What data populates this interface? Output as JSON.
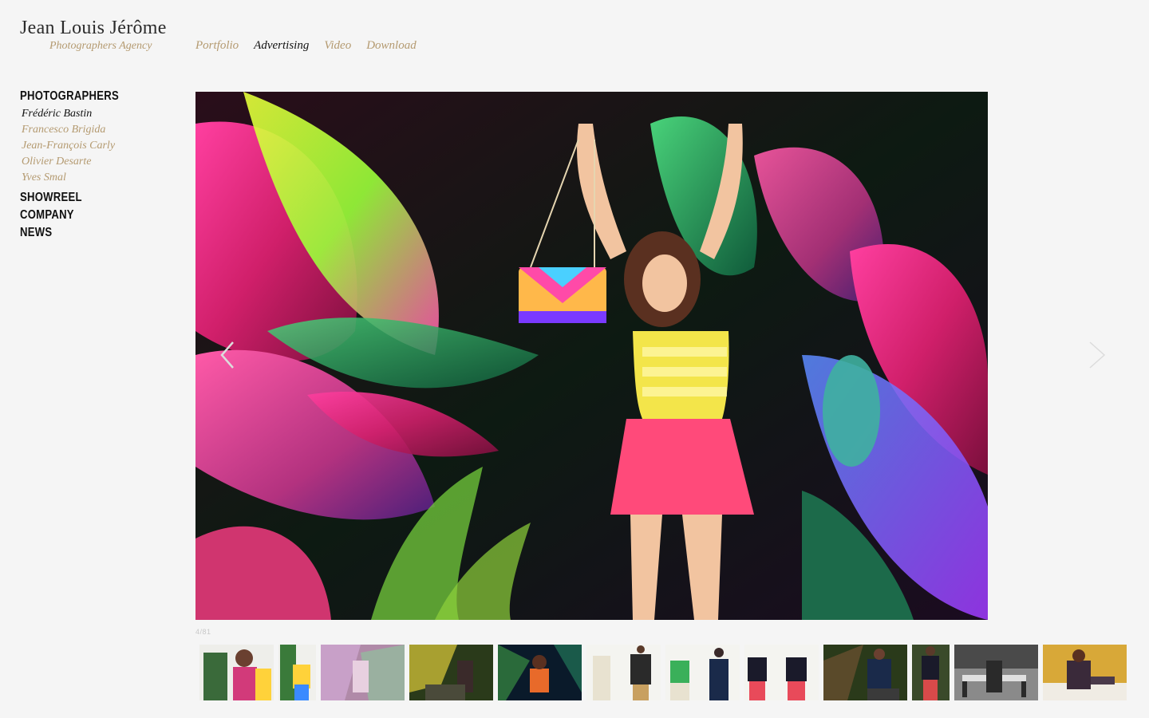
{
  "brand": {
    "title": "Jean Louis Jérôme",
    "subtitle": "Photographers Agency"
  },
  "topnav": {
    "items": [
      "Portfolio",
      "Advertising",
      "Video",
      "Download"
    ],
    "active": "Advertising"
  },
  "sidebar": {
    "photographers_heading": "PHOTOGRAPHERS",
    "photographers": [
      "Frédéric Bastin",
      "Francesco Brigida",
      "Jean-François Carly",
      "Olivier Desarte",
      "Yves Smal"
    ],
    "active_photographer": "Frédéric Bastin",
    "showreel": "SHOWREEL",
    "company": "COMPANY",
    "news": "NEWS"
  },
  "gallery": {
    "counter": "4/81",
    "prev_icon": "chevron-left-icon",
    "next_icon": "chevron-right-icon",
    "thumbnail_count": 12
  },
  "colors": {
    "background": "#f5f5f5",
    "accent_gold": "#b49a70",
    "text_dark": "#111111"
  }
}
